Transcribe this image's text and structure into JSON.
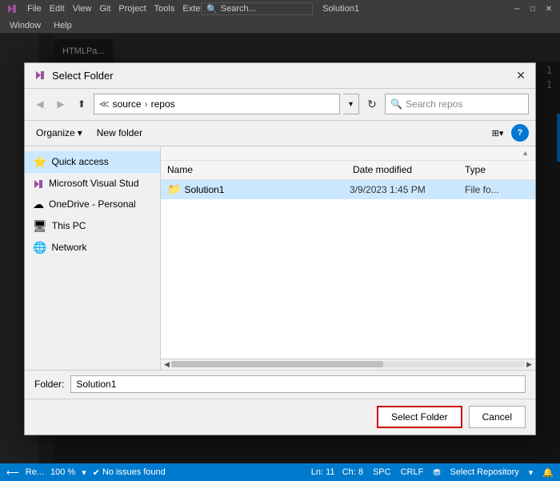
{
  "titleBar": {
    "menus": [
      "File",
      "Edit",
      "View",
      "Git",
      "Project",
      "Tools",
      "Extensions"
    ],
    "submenus": [
      "Window",
      "Help"
    ],
    "searchPlaceholder": "Search...",
    "appTitle": "Solution1",
    "windowControls": [
      "minimize",
      "maximize",
      "close"
    ]
  },
  "editorTab": {
    "label": "HTMLPa..."
  },
  "editorLines": [
    "1",
    "1"
  ],
  "dialog": {
    "title": "Select Folder",
    "addressPath": {
      "parts": [
        "source",
        "repos"
      ],
      "separator": ">"
    },
    "searchPlaceholder": "Search repos",
    "toolbar": {
      "organizeLabel": "Organize",
      "newFolderLabel": "New folder"
    },
    "navItems": [
      {
        "icon": "⭐",
        "label": "Quick access",
        "selected": true
      },
      {
        "icon": "🟣",
        "label": "Microsoft Visual Stud",
        "selected": false
      },
      {
        "icon": "☁",
        "label": "OneDrive - Personal",
        "selected": false
      },
      {
        "icon": "🖥",
        "label": "This PC",
        "selected": false
      },
      {
        "icon": "🌐",
        "label": "Network",
        "selected": false
      }
    ],
    "fileList": {
      "columns": [
        "Name",
        "Date modified",
        "Type"
      ],
      "rows": [
        {
          "icon": "📁",
          "name": "Solution1",
          "date": "3/9/2023 1:45 PM",
          "type": "File fo..."
        }
      ]
    },
    "folderLabel": "Folder:",
    "folderValue": "Solution1",
    "buttons": {
      "selectFolder": "Select Folder",
      "cancel": "Cancel"
    }
  },
  "statusBar": {
    "branchIcon": "⟵",
    "zoomLevel": "100 %",
    "issues": "No issues found",
    "position": "Ln: 11",
    "col": "Ch: 8",
    "encoding": "SPC",
    "lineEnding": "CRLF",
    "repoLabel": "Re...",
    "repoSelectLabel": "Select Repository"
  }
}
